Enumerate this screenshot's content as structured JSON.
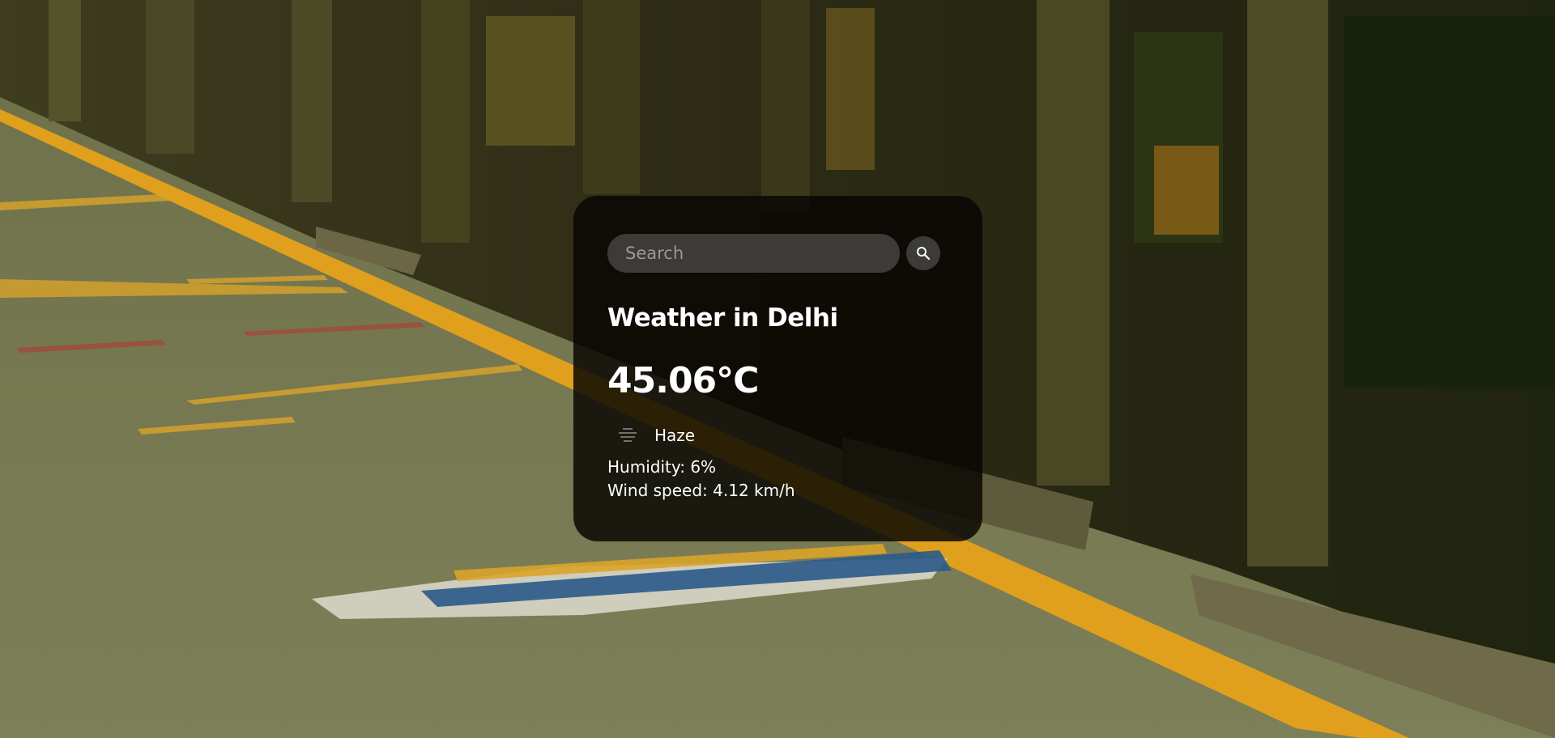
{
  "search": {
    "placeholder": "Search",
    "value": ""
  },
  "weather": {
    "title": "Weather in Delhi",
    "temperature": "45.06°C",
    "condition": "Haze",
    "condition_icon": "haze-icon",
    "humidity": "Humidity: 6%",
    "wind": "Wind speed: 4.12 km/h"
  },
  "icons": {
    "search": "search-icon"
  },
  "colors": {
    "card_background": "#080602",
    "text": "#ffffff",
    "input_background": "#3c3b37",
    "platform_line": "#e6a21a"
  }
}
